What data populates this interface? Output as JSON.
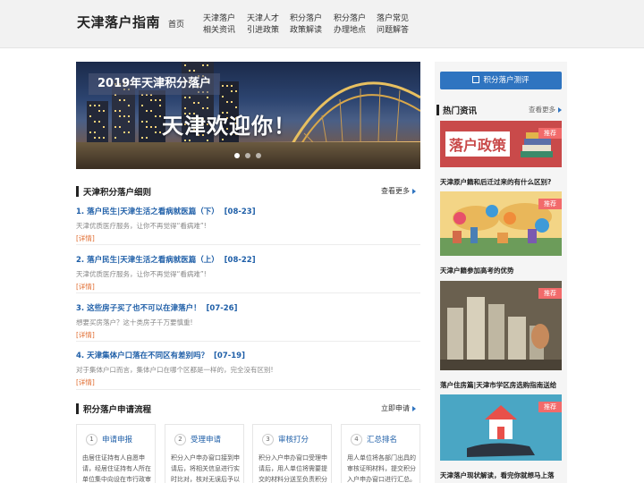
{
  "header": {
    "logo": "天津落户指南",
    "home": "首页",
    "nav": [
      {
        "line1": "天津落户",
        "line2": "相关资讯"
      },
      {
        "line1": "天津人才",
        "line2": "引进政策"
      },
      {
        "line1": "积分落户",
        "line2": "政策解读"
      },
      {
        "line1": "积分落户",
        "line2": "办理地点"
      },
      {
        "line1": "落户常见",
        "line2": "问题解答"
      }
    ]
  },
  "banner": {
    "badge": "2019年天津积分落户",
    "title": "天津欢迎你！",
    "dots_count": 3
  },
  "details": {
    "title": "天津积分落户细则",
    "more": "查看更多",
    "articles": [
      {
        "title": "1. 落户民生|天津生活之看病就医篇（下）",
        "date": "[08-23]",
        "desc": "天津优质医疗服务，让你不再觉得“看病难”!",
        "link": "[详情]"
      },
      {
        "title": "2. 落户民生|天津生活之看病就医篇（上）",
        "date": "[08-22]",
        "desc": "天津优质医疗服务，让你不再觉得“看病难”!",
        "link": "[详情]"
      },
      {
        "title": "3. 这些房子买了也不可以在津落户！",
        "date": "[07-26]",
        "desc": "想要买房落户？这十类房子千万要慎重!",
        "link": "[详情]"
      },
      {
        "title": "4. 天津集体户口落在不同区有差别吗？",
        "date": "[07-19]",
        "desc": "对于集体户口而言，集体户口在哪个区都是一样的，完全没有区别!",
        "link": "[详情]"
      }
    ]
  },
  "process": {
    "title": "积分落户申请流程",
    "more": "立即申请",
    "steps": [
      {
        "num": "1",
        "title": "申请申报",
        "desc": "由居住证持有人自愿申请，经居住证持有人所在单位集中向设在市行政审"
      },
      {
        "num": "2",
        "title": "受理申请",
        "desc": "积分入户申办窗口接到申请后，将相关信息进行实时比对，核对无误后予以受理"
      },
      {
        "num": "3",
        "title": "审核打分",
        "desc": "积分入户申办窗口受理申请后，用人单位将需要提交的材料分送至负责积分"
      },
      {
        "num": "4",
        "title": "汇总排名",
        "desc": "用人单位将各部门出具的审核证明材料，提交积分入户申办窗口进行汇总。"
      }
    ]
  },
  "sidebar": {
    "eval_button": "积分落户测评",
    "hot_title": "热门资讯",
    "hot_more": "查看更多",
    "policy_banner_text": "落户政策",
    "tag": "推荐",
    "items": [
      {
        "caption": "天津原户籍和后迁过来的有什么区别?"
      },
      {
        "caption": "天津户籍参加高考的优势"
      },
      {
        "caption": "落户住房篇|天津市学区房选购指南送给"
      },
      {
        "caption": "天津落户现状解读，看完你就想马上落"
      }
    ]
  },
  "colors": {
    "accent": "#2f74c0",
    "tag": "#f26b6b",
    "link_orange": "#e06a2c"
  }
}
